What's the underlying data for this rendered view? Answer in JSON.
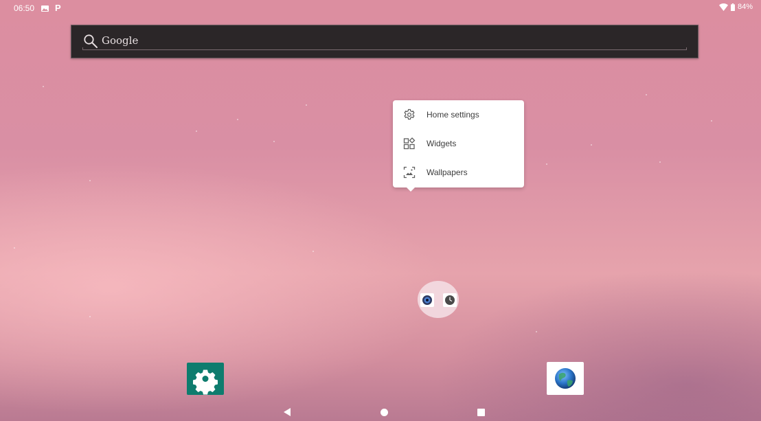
{
  "status_bar": {
    "time": "06:50",
    "battery": "84%",
    "icons": [
      "photo-icon",
      "p-notification-icon",
      "wifi-icon",
      "battery-icon"
    ]
  },
  "search_widget": {
    "label": "Google",
    "icon": "search-icon"
  },
  "popup_menu": {
    "items": [
      {
        "label": "Home settings",
        "icon": "gear-icon"
      },
      {
        "label": "Widgets",
        "icon": "widgets-icon"
      },
      {
        "label": "Wallpapers",
        "icon": "wallpaper-icon"
      }
    ]
  },
  "folder": {
    "apps": [
      "camera-app-icon",
      "clock-app-icon"
    ]
  },
  "dock": {
    "apps": [
      {
        "icon": "settings-app-icon",
        "color": "#0e7c6e"
      },
      {
        "icon": "browser-globe-icon",
        "color": "#2a74c8"
      }
    ]
  },
  "nav_bar": {
    "buttons": [
      "back-button",
      "home-button",
      "recents-button"
    ]
  },
  "colors": {
    "wallpaper": "#dc8ea0",
    "search_bar": "#2b2628",
    "menu_background": "#ffffff",
    "settings_app": "#0e7c6e"
  }
}
